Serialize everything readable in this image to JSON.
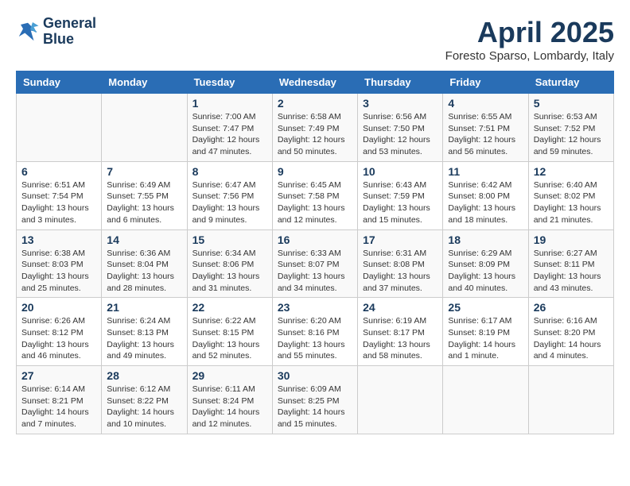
{
  "header": {
    "logo_line1": "General",
    "logo_line2": "Blue",
    "month_title": "April 2025",
    "location": "Foresto Sparso, Lombardy, Italy"
  },
  "days_of_week": [
    "Sunday",
    "Monday",
    "Tuesday",
    "Wednesday",
    "Thursday",
    "Friday",
    "Saturday"
  ],
  "weeks": [
    [
      {
        "day": "",
        "info": ""
      },
      {
        "day": "",
        "info": ""
      },
      {
        "day": "1",
        "info": "Sunrise: 7:00 AM\nSunset: 7:47 PM\nDaylight: 12 hours and 47 minutes."
      },
      {
        "day": "2",
        "info": "Sunrise: 6:58 AM\nSunset: 7:49 PM\nDaylight: 12 hours and 50 minutes."
      },
      {
        "day": "3",
        "info": "Sunrise: 6:56 AM\nSunset: 7:50 PM\nDaylight: 12 hours and 53 minutes."
      },
      {
        "day": "4",
        "info": "Sunrise: 6:55 AM\nSunset: 7:51 PM\nDaylight: 12 hours and 56 minutes."
      },
      {
        "day": "5",
        "info": "Sunrise: 6:53 AM\nSunset: 7:52 PM\nDaylight: 12 hours and 59 minutes."
      }
    ],
    [
      {
        "day": "6",
        "info": "Sunrise: 6:51 AM\nSunset: 7:54 PM\nDaylight: 13 hours and 3 minutes."
      },
      {
        "day": "7",
        "info": "Sunrise: 6:49 AM\nSunset: 7:55 PM\nDaylight: 13 hours and 6 minutes."
      },
      {
        "day": "8",
        "info": "Sunrise: 6:47 AM\nSunset: 7:56 PM\nDaylight: 13 hours and 9 minutes."
      },
      {
        "day": "9",
        "info": "Sunrise: 6:45 AM\nSunset: 7:58 PM\nDaylight: 13 hours and 12 minutes."
      },
      {
        "day": "10",
        "info": "Sunrise: 6:43 AM\nSunset: 7:59 PM\nDaylight: 13 hours and 15 minutes."
      },
      {
        "day": "11",
        "info": "Sunrise: 6:42 AM\nSunset: 8:00 PM\nDaylight: 13 hours and 18 minutes."
      },
      {
        "day": "12",
        "info": "Sunrise: 6:40 AM\nSunset: 8:02 PM\nDaylight: 13 hours and 21 minutes."
      }
    ],
    [
      {
        "day": "13",
        "info": "Sunrise: 6:38 AM\nSunset: 8:03 PM\nDaylight: 13 hours and 25 minutes."
      },
      {
        "day": "14",
        "info": "Sunrise: 6:36 AM\nSunset: 8:04 PM\nDaylight: 13 hours and 28 minutes."
      },
      {
        "day": "15",
        "info": "Sunrise: 6:34 AM\nSunset: 8:06 PM\nDaylight: 13 hours and 31 minutes."
      },
      {
        "day": "16",
        "info": "Sunrise: 6:33 AM\nSunset: 8:07 PM\nDaylight: 13 hours and 34 minutes."
      },
      {
        "day": "17",
        "info": "Sunrise: 6:31 AM\nSunset: 8:08 PM\nDaylight: 13 hours and 37 minutes."
      },
      {
        "day": "18",
        "info": "Sunrise: 6:29 AM\nSunset: 8:09 PM\nDaylight: 13 hours and 40 minutes."
      },
      {
        "day": "19",
        "info": "Sunrise: 6:27 AM\nSunset: 8:11 PM\nDaylight: 13 hours and 43 minutes."
      }
    ],
    [
      {
        "day": "20",
        "info": "Sunrise: 6:26 AM\nSunset: 8:12 PM\nDaylight: 13 hours and 46 minutes."
      },
      {
        "day": "21",
        "info": "Sunrise: 6:24 AM\nSunset: 8:13 PM\nDaylight: 13 hours and 49 minutes."
      },
      {
        "day": "22",
        "info": "Sunrise: 6:22 AM\nSunset: 8:15 PM\nDaylight: 13 hours and 52 minutes."
      },
      {
        "day": "23",
        "info": "Sunrise: 6:20 AM\nSunset: 8:16 PM\nDaylight: 13 hours and 55 minutes."
      },
      {
        "day": "24",
        "info": "Sunrise: 6:19 AM\nSunset: 8:17 PM\nDaylight: 13 hours and 58 minutes."
      },
      {
        "day": "25",
        "info": "Sunrise: 6:17 AM\nSunset: 8:19 PM\nDaylight: 14 hours and 1 minute."
      },
      {
        "day": "26",
        "info": "Sunrise: 6:16 AM\nSunset: 8:20 PM\nDaylight: 14 hours and 4 minutes."
      }
    ],
    [
      {
        "day": "27",
        "info": "Sunrise: 6:14 AM\nSunset: 8:21 PM\nDaylight: 14 hours and 7 minutes."
      },
      {
        "day": "28",
        "info": "Sunrise: 6:12 AM\nSunset: 8:22 PM\nDaylight: 14 hours and 10 minutes."
      },
      {
        "day": "29",
        "info": "Sunrise: 6:11 AM\nSunset: 8:24 PM\nDaylight: 14 hours and 12 minutes."
      },
      {
        "day": "30",
        "info": "Sunrise: 6:09 AM\nSunset: 8:25 PM\nDaylight: 14 hours and 15 minutes."
      },
      {
        "day": "",
        "info": ""
      },
      {
        "day": "",
        "info": ""
      },
      {
        "day": "",
        "info": ""
      }
    ]
  ]
}
